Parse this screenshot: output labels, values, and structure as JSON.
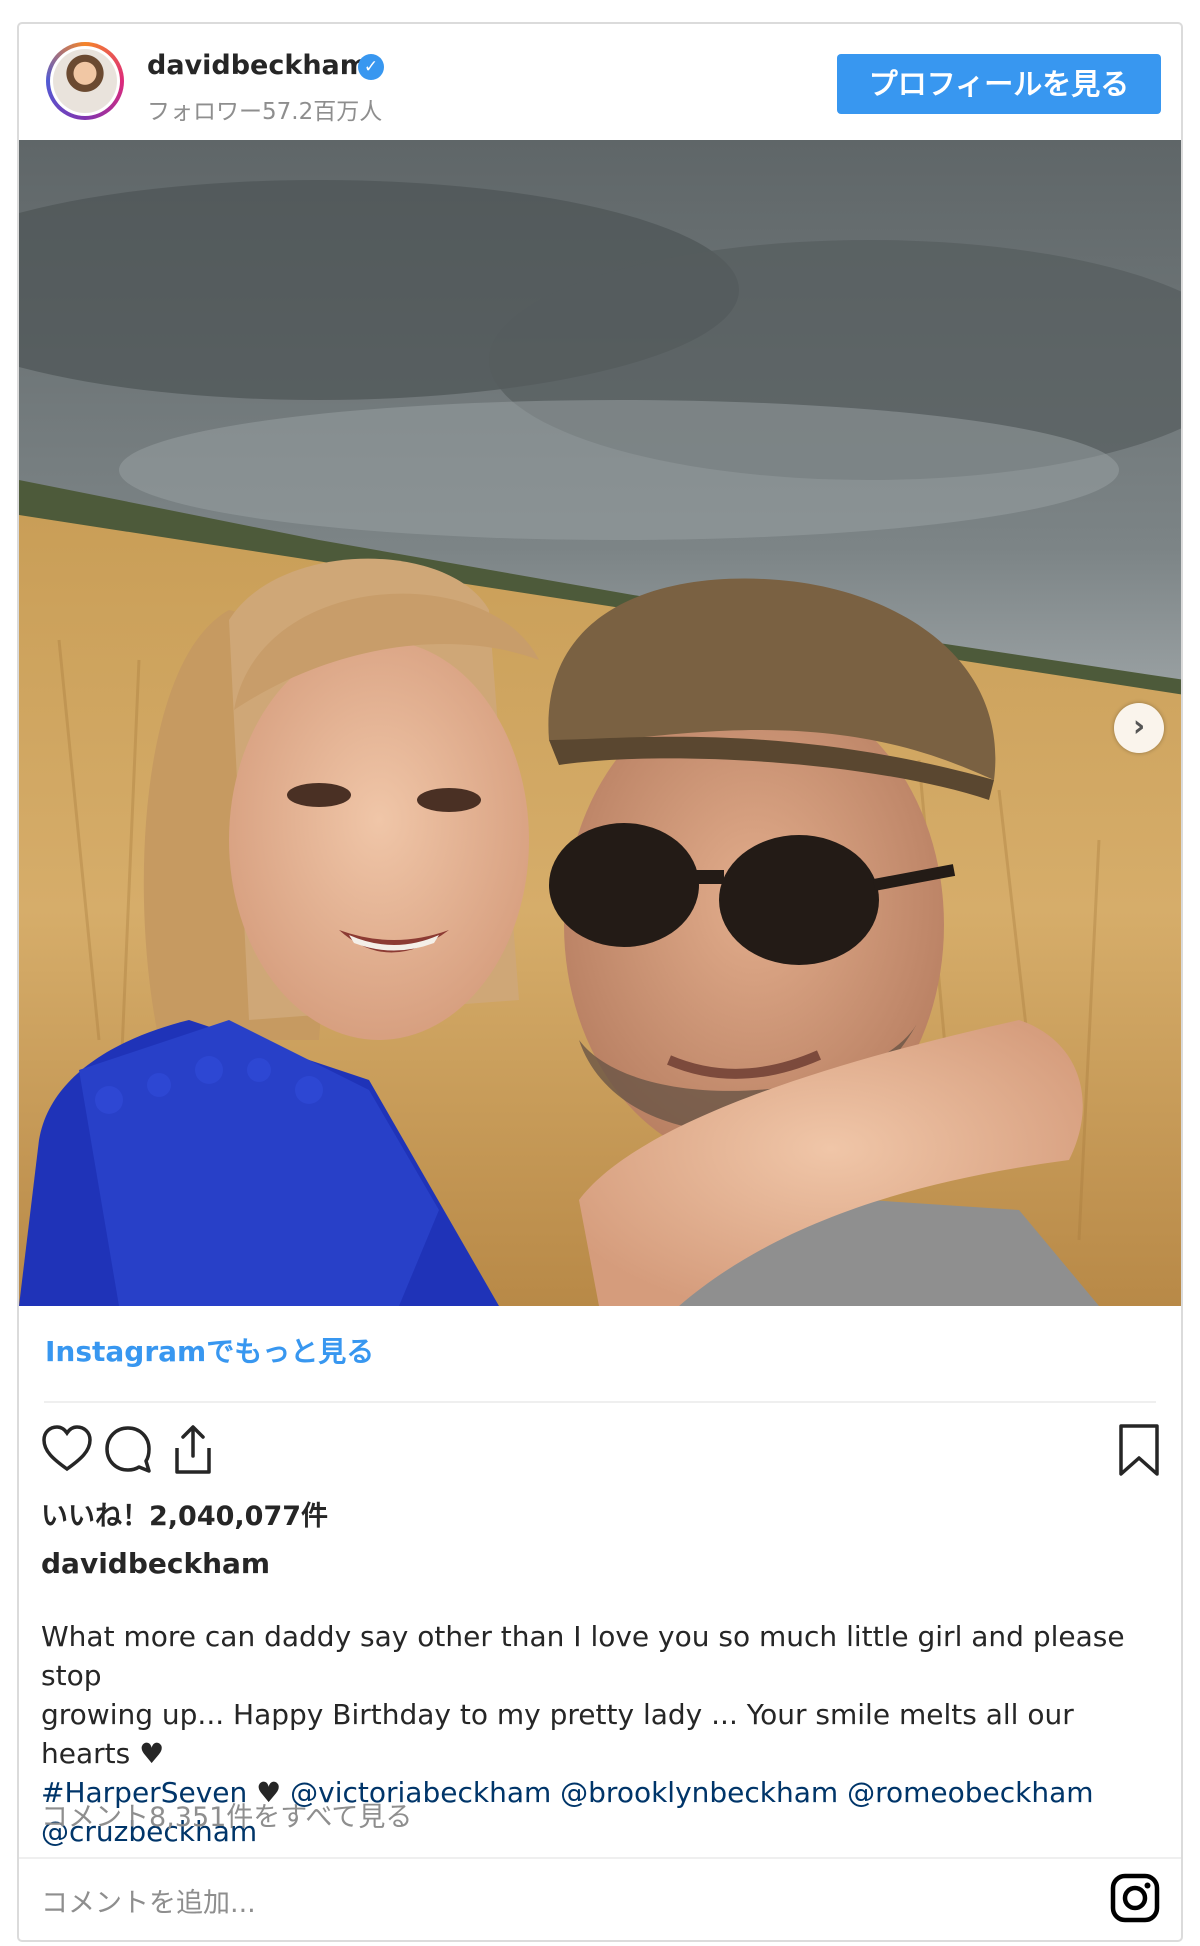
{
  "header": {
    "username": "davidbeckham",
    "verified_symbol": "✓",
    "followers": "フォロワー57.2百万人",
    "profile_button": "プロフィールを見る"
  },
  "photo": {
    "next_arrow": "›",
    "description_icon": "photo-father-daughter-wheat-field"
  },
  "links": {
    "more_on_instagram": "Instagramでもっと見る"
  },
  "actions": {
    "like_icon": "heart-icon",
    "comment_icon": "comment-icon",
    "share_icon": "share-icon",
    "save_icon": "bookmark-icon"
  },
  "post": {
    "likes": "いいね！2,040,077件",
    "author": "davidbeckham",
    "caption_line1": "What more can daddy say other than I love you so much little girl and please stop",
    "caption_line2": "growing up... Happy Birthday to my pretty lady ... Your smile melts all our hearts ♥",
    "hashtag": "#HarperSeven",
    "heart2": " ♥ ",
    "mention1": "@victoriabeckham",
    "mention2": "@brooklynbeckham",
    "mention3": "@romeobeckham",
    "mention4": "@cruzbeckham",
    "view_comments": "コメント8,351件をすべて見る"
  },
  "comment_box": {
    "placeholder": "コメントを追加..."
  },
  "colors": {
    "accent": "#3897f0",
    "link": "#003569",
    "muted": "#8e8e8e"
  }
}
